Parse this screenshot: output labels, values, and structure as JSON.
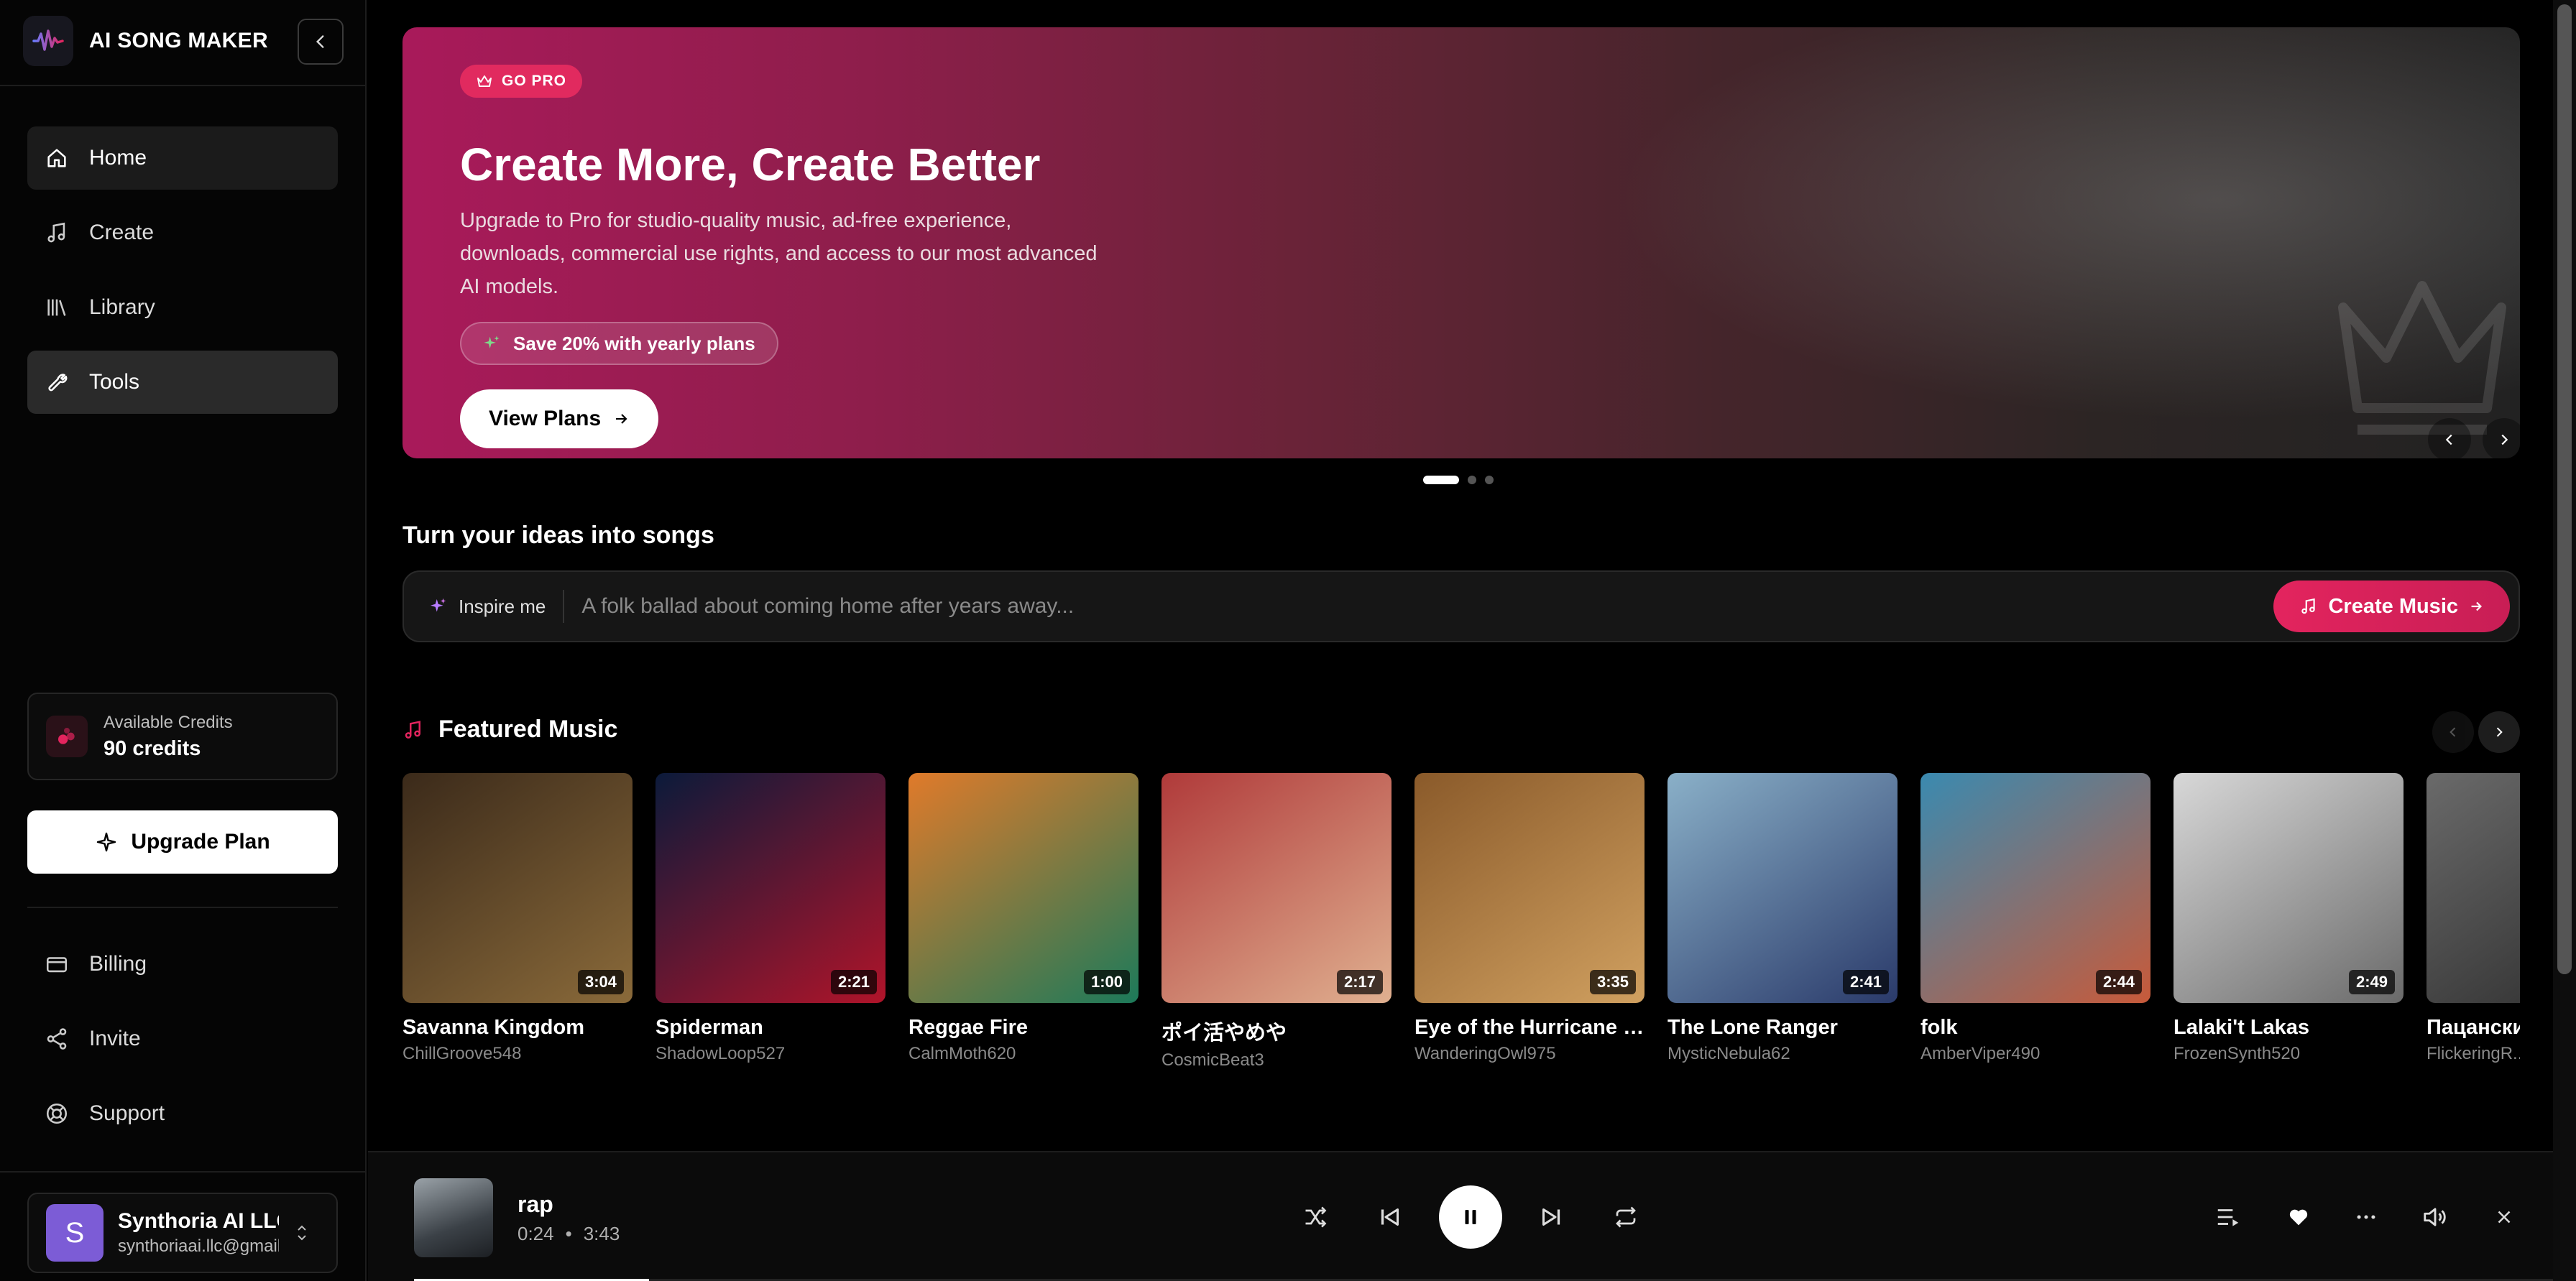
{
  "brand": {
    "name": "AI SONG MAKER"
  },
  "nav": {
    "home": "Home",
    "create": "Create",
    "library": "Library",
    "tools": "Tools",
    "billing": "Billing",
    "invite": "Invite",
    "support": "Support"
  },
  "credits": {
    "label": "Available Credits",
    "value": "90 credits"
  },
  "upgrade": {
    "label": "Upgrade Plan"
  },
  "user": {
    "initial": "S",
    "name": "Synthoria AI LLC",
    "email": "synthoriaai.llc@gmail.com"
  },
  "hero": {
    "badge": "GO PRO",
    "title": "Create More, Create Better",
    "description": "Upgrade to Pro for studio-quality music, ad-free experience, downloads, commercial use rights, and access to our most advanced AI models.",
    "save_text": "Save 20% with yearly plans",
    "cta": "View Plans",
    "slide_count": 3,
    "active_slide": 1
  },
  "prompt": {
    "heading": "Turn your ideas into songs",
    "inspire": "Inspire me",
    "placeholder": "A folk ballad about coming home after years away...",
    "create": "Create Music"
  },
  "featured": {
    "title": "Featured Music",
    "cards": [
      {
        "title": "Savanna Kingdom",
        "artist": "ChillGroove548",
        "duration": "3:04",
        "colors": [
          "#3b2a1a",
          "#8a6a3a"
        ]
      },
      {
        "title": "Spiderman",
        "artist": "ShadowLoop527",
        "duration": "2:21",
        "colors": [
          "#0b1a3a",
          "#b0142a"
        ]
      },
      {
        "title": "Reggae Fire",
        "artist": "CalmMoth620",
        "duration": "1:00",
        "colors": [
          "#e07a2a",
          "#1c7a5a"
        ]
      },
      {
        "title": "ポイ活やめや",
        "artist": "CosmicBeat3",
        "duration": "2:17",
        "colors": [
          "#b03a3a",
          "#e0b090"
        ]
      },
      {
        "title": "Eye of the Hurricane (...",
        "artist": "WanderingOwl975",
        "duration": "3:35",
        "colors": [
          "#8a5a2a",
          "#d0a060"
        ]
      },
      {
        "title": "The Lone Ranger",
        "artist": "MysticNebula62",
        "duration": "2:41",
        "colors": [
          "#8ab0c8",
          "#2a3a6a"
        ]
      },
      {
        "title": "folk",
        "artist": "AmberViper490",
        "duration": "2:44",
        "colors": [
          "#3a8ab0",
          "#c85a3a"
        ]
      },
      {
        "title": "Lalaki't Lakas",
        "artist": "FrozenSynth520",
        "duration": "2:49",
        "colors": [
          "#d8d8d8",
          "#6a6a6a"
        ]
      },
      {
        "title": "Пацанские",
        "artist": "FlickeringR...",
        "duration": "",
        "colors": [
          "#6a6a6a",
          "#2a2a2a"
        ]
      }
    ]
  },
  "player": {
    "title": "rap",
    "current": "0:24",
    "separator": "•",
    "total": "3:43",
    "progress": 0.11
  }
}
